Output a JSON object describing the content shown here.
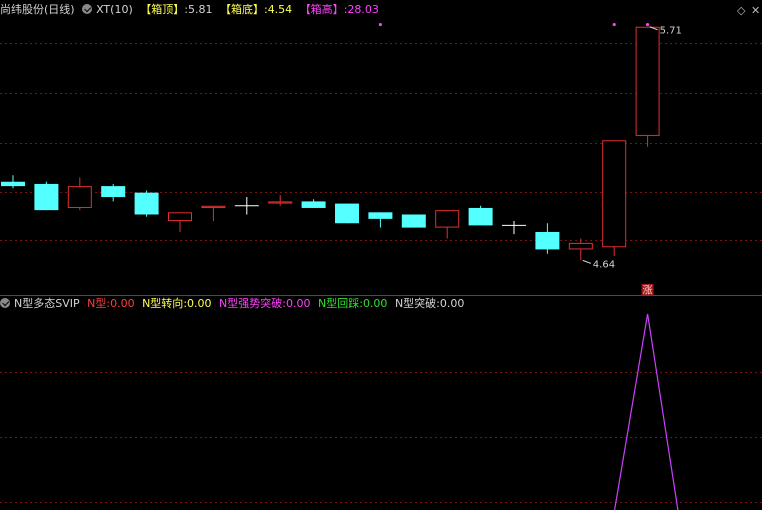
{
  "main_panel": {
    "stock_label": "尚纬股份(日线)",
    "indicator_name": "XT(10)",
    "items": [
      {
        "label": "【箱顶】",
        "value": "5.81",
        "label_color": "#ffff54",
        "value_color": "#d4d4d4"
      },
      {
        "label": "【箱底】",
        "value": "4.54",
        "label_color": "#ffff54",
        "value_color": "#ffff54"
      },
      {
        "label": "【箱高】",
        "value": "28.03",
        "label_color": "#ff40ff",
        "value_color": "#ff40ff"
      }
    ]
  },
  "sub_panel": {
    "indicator_name": "N型多态SVIP",
    "items": [
      {
        "label": "N型",
        "value": "0.00",
        "color": "#ff3c3c"
      },
      {
        "label": "N型转向",
        "value": "0.00",
        "color": "#ffff54"
      },
      {
        "label": "N型强势突破",
        "value": "0.00",
        "color": "#ff40ff"
      },
      {
        "label": "N型回踩",
        "value": "0.00",
        "color": "#30e030"
      },
      {
        "label": "N型突破",
        "value": "0.00",
        "color": "#d4d4d4"
      }
    ]
  },
  "buttons": {
    "settings": "◇",
    "close": "✕"
  },
  "colors": {
    "up": "#e03030",
    "down": "#54ffff",
    "grid": "#7a1414",
    "separator": "#b02020",
    "signal_dot": "#ff40ff",
    "spike": "#cc40ff",
    "zhang_badge_bg": "#a01818",
    "zhang_badge_fg": "#ffd0d0"
  },
  "chart_data": [
    {
      "type": "candlestick",
      "annotations": {
        "high_label": "5.71",
        "low_label": "4.64",
        "badge": "涨"
      },
      "ylim": [
        4.55,
        5.75
      ],
      "candles": [
        {
          "o": 5.0,
          "c": 4.98,
          "h": 5.03,
          "l": 4.97
        },
        {
          "o": 4.99,
          "c": 4.87,
          "h": 5.0,
          "l": 4.87
        },
        {
          "o": 4.88,
          "c": 4.98,
          "h": 5.02,
          "l": 4.87
        },
        {
          "o": 4.98,
          "c": 4.93,
          "h": 4.99,
          "l": 4.91
        },
        {
          "o": 4.95,
          "c": 4.85,
          "h": 4.96,
          "l": 4.84
        },
        {
          "o": 4.82,
          "c": 4.86,
          "h": 4.86,
          "l": 4.77
        },
        {
          "o": 4.88,
          "c": 4.89,
          "h": 4.89,
          "l": 4.82
        },
        {
          "o": 4.89,
          "c": 4.89,
          "h": 4.93,
          "l": 4.85
        },
        {
          "o": 4.9,
          "c": 4.91,
          "h": 4.94,
          "l": 4.89
        },
        {
          "o": 4.91,
          "c": 4.88,
          "h": 4.92,
          "l": 4.88
        },
        {
          "o": 4.9,
          "c": 4.81,
          "h": 4.9,
          "l": 4.81
        },
        {
          "o": 4.86,
          "c": 4.83,
          "h": 4.86,
          "l": 4.79
        },
        {
          "o": 4.85,
          "c": 4.79,
          "h": 4.85,
          "l": 4.79
        },
        {
          "o": 4.79,
          "c": 4.87,
          "h": 4.87,
          "l": 4.74
        },
        {
          "o": 4.88,
          "c": 4.8,
          "h": 4.89,
          "l": 4.8
        },
        {
          "o": 4.8,
          "c": 4.8,
          "h": 4.82,
          "l": 4.76
        },
        {
          "o": 4.77,
          "c": 4.69,
          "h": 4.81,
          "l": 4.67
        },
        {
          "o": 4.69,
          "c": 4.72,
          "h": 4.74,
          "l": 4.64
        },
        {
          "o": 4.7,
          "c": 5.19,
          "h": 5.19,
          "l": 4.66
        },
        {
          "o": 5.21,
          "c": 5.71,
          "h": 5.71,
          "l": 5.16
        }
      ],
      "signal_dots": [
        {
          "index": 11,
          "value": 5.72
        },
        {
          "index": 18,
          "value": 5.72
        },
        {
          "index": 19,
          "value": 5.72
        }
      ]
    },
    {
      "type": "line",
      "series": [
        {
          "values": [
            0,
            0,
            0,
            0,
            0,
            0,
            0,
            0,
            0,
            0,
            0,
            0,
            0,
            0,
            0,
            0,
            0,
            0,
            0,
            1,
            0
          ]
        }
      ],
      "ylim": [
        0,
        1
      ]
    }
  ]
}
